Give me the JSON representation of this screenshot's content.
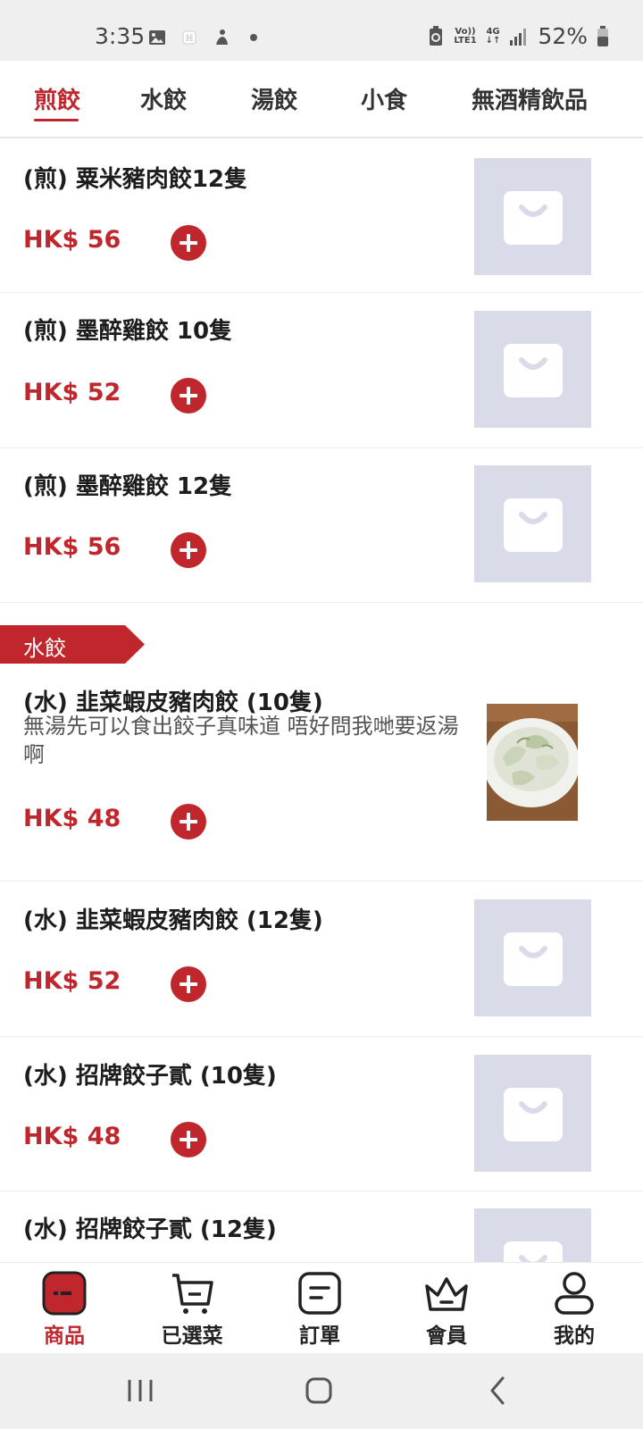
{
  "status_bar": {
    "time": "3:35",
    "network_top": "Vo))",
    "network_bottom": "LTE1",
    "network_type": "4G",
    "battery": "52%"
  },
  "tabs": [
    {
      "label": "煎餃",
      "active": true
    },
    {
      "label": "水餃",
      "active": false
    },
    {
      "label": "湯餃",
      "active": false
    },
    {
      "label": "小食",
      "active": false
    },
    {
      "label": "無酒精飲品",
      "active": false
    }
  ],
  "section_tag": {
    "label": "水餃"
  },
  "items": [
    {
      "title": "(煎) 粟米豬肉餃12隻",
      "price": "HK$ 56",
      "image": "bag-placeholder-icon"
    },
    {
      "title": "(煎) 墨醉雞餃 10隻",
      "price": "HK$ 52",
      "image": "bag-placeholder-icon"
    },
    {
      "title": "(煎) 墨醉雞餃 12隻",
      "price": "HK$ 56",
      "image": "bag-placeholder-icon"
    },
    {
      "title": "(水) 韭菜蝦皮豬肉餃 (10隻)",
      "description": "無湯先可以食出餃子真味道 唔好問我哋要返湯啊",
      "price": "HK$ 48",
      "image": "dumpling-photo"
    },
    {
      "title": "(水) 韭菜蝦皮豬肉餃 (12隻)",
      "price": "HK$ 52",
      "image": "bag-placeholder-icon"
    },
    {
      "title": "(水) 招牌餃子貳 (10隻)",
      "price": "HK$ 48",
      "image": "bag-placeholder-icon"
    },
    {
      "title": "(水) 招牌餃子貳 (12隻)",
      "image": "bag-placeholder-icon"
    }
  ],
  "bottom_nav": [
    {
      "label": "商品",
      "icon": "product-icon",
      "active": true
    },
    {
      "label": "已選菜",
      "icon": "cart-icon",
      "active": false
    },
    {
      "label": "訂單",
      "icon": "order-icon",
      "active": false
    },
    {
      "label": "會員",
      "icon": "crown-icon",
      "active": false
    },
    {
      "label": "我的",
      "icon": "profile-icon",
      "active": false
    }
  ],
  "colors": {
    "accent": "#c0272d",
    "placeholder_bg": "#d9dbe8",
    "status_bar_bg": "#efefef"
  }
}
